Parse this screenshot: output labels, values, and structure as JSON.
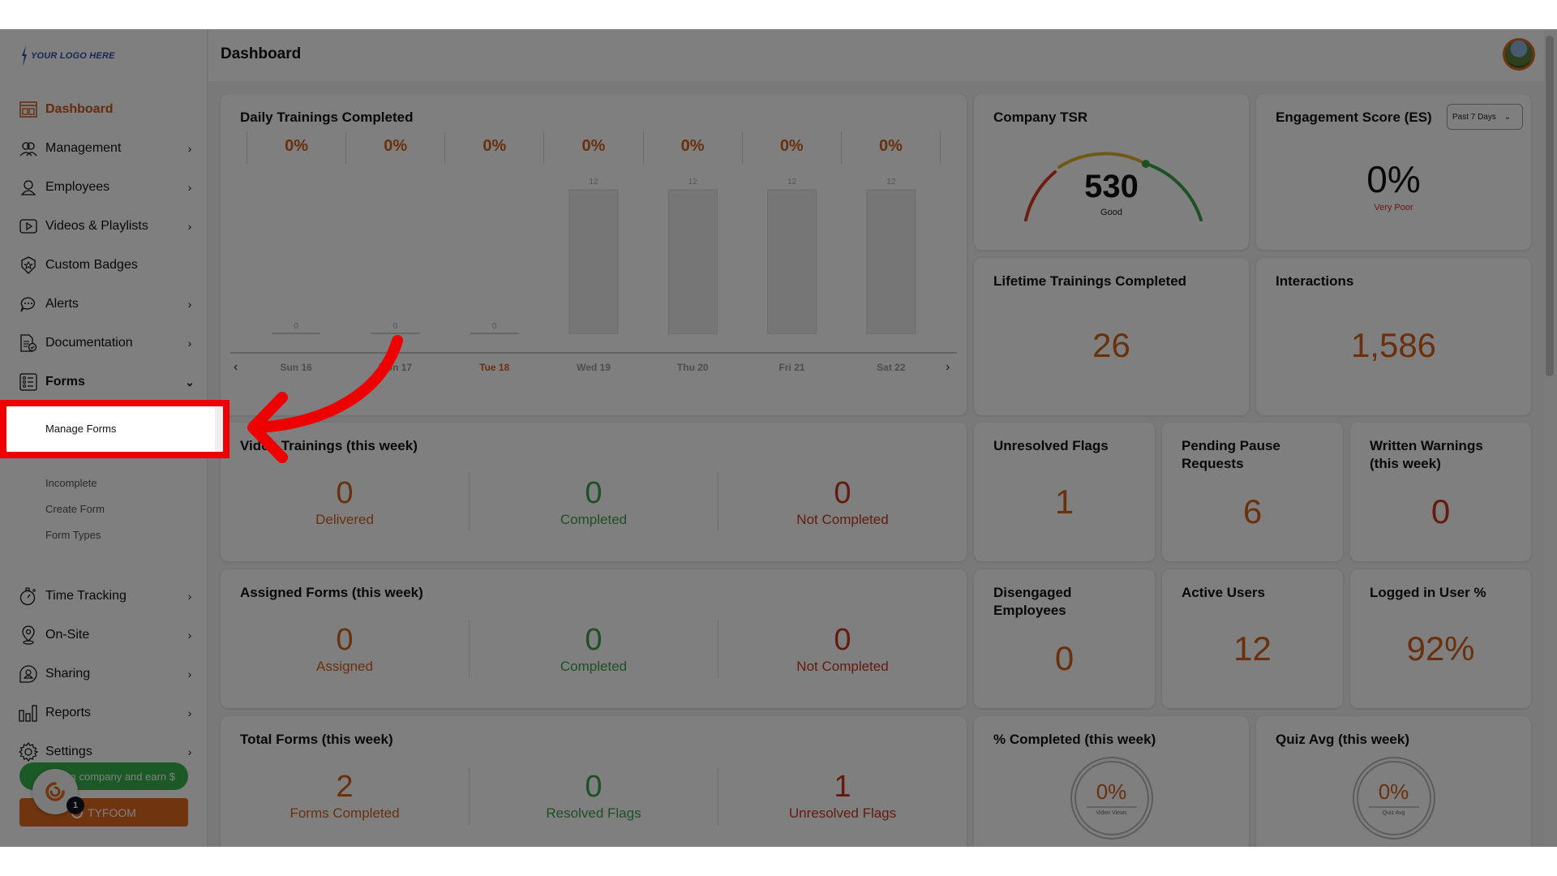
{
  "sidebar": {
    "logo_text": "YOUR LOGO HERE",
    "items": [
      {
        "label": "Dashboard",
        "icon": "dashboard-icon",
        "active": true
      },
      {
        "label": "Management",
        "icon": "management-icon",
        "chevron": "›"
      },
      {
        "label": "Employees",
        "icon": "employees-icon",
        "chevron": "›"
      },
      {
        "label": "Videos & Playlists",
        "icon": "video-icon",
        "chevron": "›"
      },
      {
        "label": "Custom Badges",
        "icon": "badge-icon"
      },
      {
        "label": "Alerts",
        "icon": "alerts-icon",
        "chevron": "›"
      },
      {
        "label": "Documentation",
        "icon": "documentation-icon",
        "chevron": "›"
      },
      {
        "label": "Forms",
        "icon": "forms-icon",
        "chevron": "⌄",
        "expanded": true
      },
      {
        "label": "Time Tracking",
        "icon": "stopwatch-icon",
        "chevron": "›"
      },
      {
        "label": "On-Site",
        "icon": "location-pin-icon",
        "chevron": "›"
      },
      {
        "label": "Sharing",
        "icon": "sharing-icon",
        "chevron": "›"
      },
      {
        "label": "Reports",
        "icon": "reports-icon",
        "chevron": "›"
      },
      {
        "label": "Settings",
        "icon": "gear-icon",
        "chevron": "›"
      }
    ],
    "forms_submenu": [
      "Manage Forms",
      "Incomplete",
      "Create Form",
      "Form Types"
    ],
    "refer_button": "Refer a company and earn $",
    "tyfoom_button": "TYFOOM",
    "launcher_badge": "1"
  },
  "header": {
    "title": "Dashboard"
  },
  "daily_trainings": {
    "title": "Daily Trainings Completed",
    "prev": "‹",
    "next": "›"
  },
  "company_tsr": {
    "title": "Company TSR",
    "value": "530",
    "rating": "Good",
    "gauge_fraction": 0.66,
    "colors": {
      "poor": "#d63a1f",
      "fair": "#e3b22a",
      "good": "#3aa14a"
    }
  },
  "engagement": {
    "title": "Engagement Score (ES)",
    "period": "Past 7 Days",
    "value": "0%",
    "rating": "Very Poor"
  },
  "lifetime": {
    "title": "Lifetime Trainings Completed",
    "value": "26"
  },
  "interactions": {
    "title": "Interactions",
    "value": "1,586"
  },
  "video_trainings": {
    "title": "Video Trainings (this week)",
    "stats": [
      {
        "value": "0",
        "label": "Delivered"
      },
      {
        "value": "0",
        "label": "Completed"
      },
      {
        "value": "0",
        "label": "Not Completed"
      }
    ]
  },
  "assigned_forms": {
    "title": "Assigned Forms (this week)",
    "stats": [
      {
        "value": "0",
        "label": "Assigned"
      },
      {
        "value": "0",
        "label": "Completed"
      },
      {
        "value": "0",
        "label": "Not Completed"
      }
    ]
  },
  "total_forms": {
    "title": "Total Forms (this week)",
    "stats": [
      {
        "value": "2",
        "label": "Forms Completed"
      },
      {
        "value": "0",
        "label": "Resolved Flags"
      },
      {
        "value": "1",
        "label": "Unresolved Flags"
      }
    ]
  },
  "small_cards": [
    {
      "title": "Unresolved Flags",
      "value": "1"
    },
    {
      "title": "Pending Pause Requests",
      "value": "6"
    },
    {
      "title": "Written Warnings (this week)",
      "value": "0"
    },
    {
      "title": "Disengaged Employees",
      "value": "0"
    },
    {
      "title": "Active Users",
      "value": "12"
    },
    {
      "title": "Logged in User %",
      "value": "92%"
    }
  ],
  "percent_completed": {
    "title": "% Completed (this week)",
    "value": "0%",
    "caption": "Video Views"
  },
  "quiz_avg": {
    "title": "Quiz Avg (this week)",
    "value": "0%",
    "caption": "Quiz Avg"
  },
  "chart_data": {
    "type": "bar",
    "title": "Daily Trainings Completed",
    "categories": [
      "Sun 16",
      "Mon 17",
      "Tue 18",
      "Wed 19",
      "Thu 20",
      "Fri 21",
      "Sat 22"
    ],
    "values": [
      0,
      0,
      0,
      12,
      12,
      12,
      12
    ],
    "completion_percent": [
      "0%",
      "0%",
      "0%",
      "0%",
      "0%",
      "0%",
      "0%"
    ],
    "highlighted_category": "Tue 18",
    "xlabel": "",
    "ylabel": "",
    "ylim": [
      0,
      12
    ],
    "grid": false
  },
  "annotation": {
    "highlighted_item": "Manage Forms",
    "color": "#ee0000"
  }
}
